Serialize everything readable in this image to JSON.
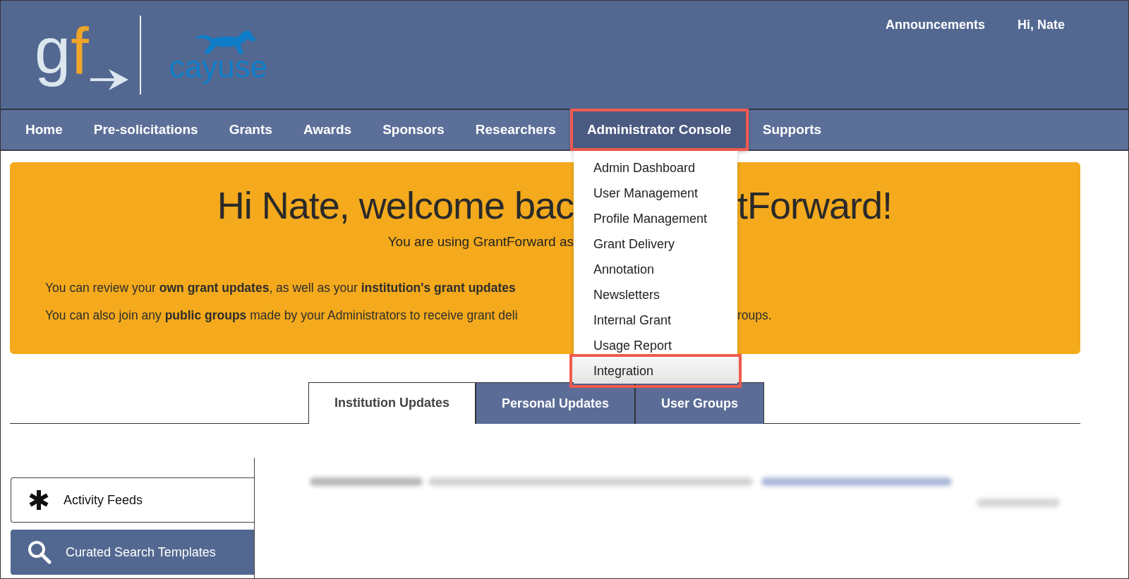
{
  "brand": {
    "mark_letters": [
      {
        "text": "g",
        "color": "#dce6ef"
      },
      {
        "text": "f",
        "color": "#eea52a"
      }
    ],
    "partner": "cayuse"
  },
  "top_links": [
    "Announcements",
    "Hi, Nate"
  ],
  "nav": [
    {
      "label": "Home",
      "active": false,
      "highlighted": false
    },
    {
      "label": "Pre-solicitations",
      "active": false,
      "highlighted": false
    },
    {
      "label": "Grants",
      "active": false,
      "highlighted": false
    },
    {
      "label": "Awards",
      "active": false,
      "highlighted": false
    },
    {
      "label": "Sponsors",
      "active": false,
      "highlighted": false
    },
    {
      "label": "Researchers",
      "active": false,
      "highlighted": false
    },
    {
      "label": "Administrator Console",
      "active": true,
      "highlighted": true
    },
    {
      "label": "Supports",
      "active": false,
      "highlighted": false
    }
  ],
  "dropdown": [
    {
      "label": "Admin Dashboard",
      "hovered": false,
      "highlighted": false
    },
    {
      "label": "User Management",
      "hovered": false,
      "highlighted": false
    },
    {
      "label": "Profile Management",
      "hovered": false,
      "highlighted": false
    },
    {
      "label": "Grant Delivery",
      "hovered": false,
      "highlighted": false
    },
    {
      "label": "Annotation",
      "hovered": false,
      "highlighted": false
    },
    {
      "label": "Newsletters",
      "hovered": false,
      "highlighted": false
    },
    {
      "label": "Internal Grant",
      "hovered": false,
      "highlighted": false
    },
    {
      "label": "Usage Report",
      "hovered": false,
      "highlighted": false
    },
    {
      "label": "Integration",
      "hovered": true,
      "highlighted": true
    }
  ],
  "banner": {
    "title_left": "Hi Nate, welcome bac",
    "title_right": "tForward!",
    "subtitle": "You are using GrantForward as",
    "line_1": "You can review your **own grant updates**, as well as your **institution's grant updates**",
    "line_2": "You can also join any **public groups** made by your Administrators to receive grant deli",
    "line_2_right": "roups."
  },
  "tabs": [
    {
      "label": "Institution Updates",
      "selected": true
    },
    {
      "label": "Personal Updates",
      "selected": false
    },
    {
      "label": "User Groups",
      "selected": false
    }
  ],
  "side_menu": [
    {
      "label": "Activity Feeds",
      "kind": "asterisk",
      "selected": true
    },
    {
      "label": "Curated Search Templates",
      "kind": "search",
      "selected": false
    }
  ]
}
